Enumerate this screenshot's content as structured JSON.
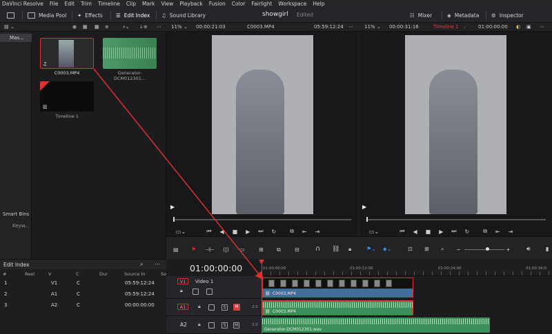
{
  "menu": [
    "DaVinci Resolve",
    "File",
    "Edit",
    "Trim",
    "Timeline",
    "Clip",
    "Mark",
    "View",
    "Playback",
    "Fusion",
    "Color",
    "Fairlight",
    "Workspace",
    "Help"
  ],
  "toolbar": {
    "media_pool": "Media Pool",
    "effects": "Effects",
    "edit_index": "Edit Index",
    "sound_library": "Sound Library",
    "project_name": "showgirl",
    "project_state": "Edited",
    "mixer": "Mixer",
    "metadata": "Metadata",
    "inspector": "Inspector"
  },
  "source_viewer": {
    "zoom": "11%",
    "duration": "00:00:21:03",
    "clip_name": "C0003.MP4",
    "timecode": "05:59:12:24"
  },
  "timeline_viewer": {
    "zoom": "11%",
    "duration": "00:00:31:16",
    "timeline_name": "Timeline 1",
    "timecode": "01:00:00:00"
  },
  "bins": {
    "master": "Mas...",
    "smart_bins": "Smart Bins",
    "keywords": "Keyw..."
  },
  "media_pool": {
    "clips": [
      {
        "name": "C0003.MP4"
      },
      {
        "name": "Generator-DCM012301..."
      },
      {
        "name": "Timeline 1"
      }
    ]
  },
  "edit_index": {
    "title": "Edit Index",
    "columns": [
      "#",
      "Reel",
      "V",
      "C",
      "Dur",
      "Source In",
      "So"
    ],
    "rows": [
      {
        "num": "1",
        "v": "V1",
        "c": "C",
        "source_in": "05:59:12:24"
      },
      {
        "num": "2",
        "v": "A1",
        "c": "C",
        "source_in": "05:59:12:24"
      },
      {
        "num": "3",
        "v": "A2",
        "c": "C",
        "source_in": "00:00:00:00"
      }
    ]
  },
  "timeline": {
    "timecode": "01:00:00:00",
    "ruler": [
      "01:00:00:00",
      "01:00:12:00",
      "01:00:24:00",
      "01:00:36:0"
    ],
    "tracks": [
      {
        "id": "V1",
        "name": "Video 1"
      },
      {
        "id": "A1",
        "level": "2.0"
      },
      {
        "id": "A2",
        "level": "2.0"
      }
    ],
    "clips": {
      "v1": "C0003.MP4",
      "a1": "C0003.MP4",
      "a2": "Generator-DCM012301.wav"
    },
    "solo": "S",
    "mute": "M"
  },
  "colors": {
    "accent_red": "#e03030",
    "video_clip": "#3f6f9e",
    "audio_clip": "#3d8f5a"
  }
}
